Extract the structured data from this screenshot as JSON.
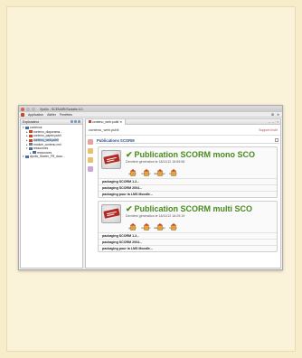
{
  "window": {
    "title": "Xpollo - SCENARI/Scolatis 4.0",
    "menu": [
      "Application",
      "Atelier",
      "Fenêtres"
    ],
    "menu_right": [
      "⊞",
      "✕"
    ]
  },
  "explorer": {
    "title": "Explorateur",
    "tree": [
      {
        "label": "contenus",
        "level": 0,
        "expanded": true,
        "color": "#4a6fa5"
      },
      {
        "label": "contenu_diaporama...",
        "level": 1,
        "expanded": false,
        "color": "#c04a2a"
      },
      {
        "label": "contenu_papier.publi",
        "level": 1,
        "expanded": false,
        "color": "#c04a2a"
      },
      {
        "label": "contenu_web.publi",
        "level": 1,
        "expanded": false,
        "color": "#c04a2a",
        "selected": true
      },
      {
        "label": "module_contenu.xml",
        "level": 1,
        "expanded": false,
        "color": "#7a7a7a"
      },
      {
        "label": "ressources",
        "level": 1,
        "expanded": true,
        "color": "#4a6fa5"
      },
      {
        "label": "ressources",
        "level": 2,
        "expanded": false,
        "color": "#4a6fa5"
      },
      {
        "label": "Apollo_Starter_FR_docu...",
        "level": 0,
        "expanded": true,
        "color": "#4a6fa5"
      }
    ]
  },
  "editor": {
    "tab_label": "contenu_web.publi",
    "tabbar_right": "←→ · ▿",
    "file_name": "contenu_web.publi",
    "support_link": "Support Inolir"
  },
  "publications": {
    "section_title": "Publications SCORM",
    "cards": [
      {
        "title": "Publication SCORM mono SCO",
        "subtitle": "Dernière génération le 18/11/12 16:59:08",
        "actions": [
          "générer",
          "consulter",
          "télécharger",
          "installer"
        ],
        "packages": [
          "packaging SCORM 1.2...",
          "packaging SCORM 2004...",
          "packaging pour la LMS Moodle..."
        ]
      },
      {
        "title": "Publication SCORM multi SCO",
        "subtitle": "Dernière génération le 18/11/12 16:29:19",
        "actions": [
          "générer",
          "consulter",
          "télécharger",
          "installer"
        ],
        "packages": [
          "packaging SCORM 1.2...",
          "packaging SCORM 2004...",
          "packaging pour la LMS Moodle..."
        ]
      }
    ]
  },
  "colors": {
    "accent_green": "#4a8a1e",
    "section_blue": "#2f4f8f",
    "brand_red": "#b52a25",
    "page_bg": "#f7edca"
  }
}
